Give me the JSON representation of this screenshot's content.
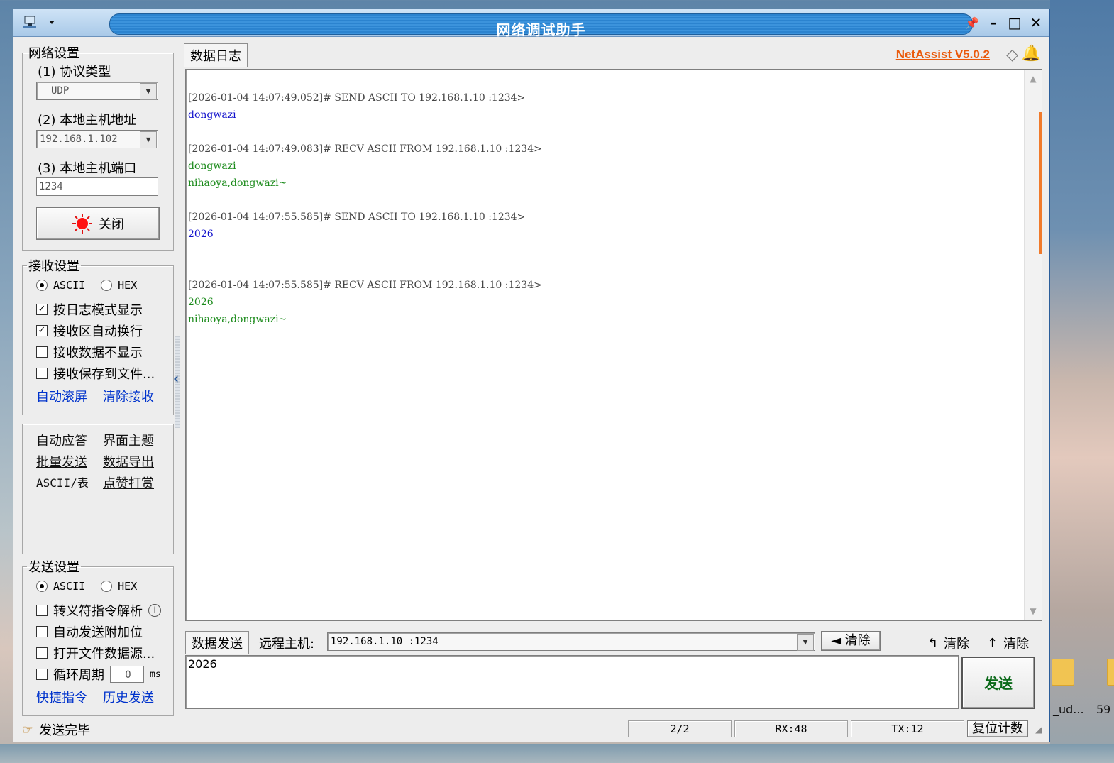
{
  "window": {
    "title": "网络调试助手"
  },
  "brand": {
    "name": "NetAssist V5.0.2"
  },
  "network_settings": {
    "legend": "网络设置",
    "protocol_label": "(1) 协议类型",
    "protocol_value": "UDP",
    "host_label": "(2) 本地主机地址",
    "host_value": "192.168.1.102",
    "port_label": "(3) 本地主机端口",
    "port_value": "1234",
    "close_button": "关闭"
  },
  "recv_settings": {
    "legend": "接收设置",
    "ascii_label": "ASCII",
    "hex_label": "HEX",
    "options": [
      {
        "label": "按日志模式显示",
        "checked": true
      },
      {
        "label": "接收区自动换行",
        "checked": true
      },
      {
        "label": "接收数据不显示",
        "checked": false
      },
      {
        "label": "接收保存到文件...",
        "checked": false
      }
    ],
    "auto_scroll": "自动滚屏",
    "clear_recv": "清除接收"
  },
  "tools": {
    "auto_reply": "自动应答",
    "theme": "界面主题",
    "batch_send": "批量发送",
    "export": "数据导出",
    "ascii_table": "ASCII/表",
    "reward": "点赞打赏"
  },
  "send_settings": {
    "legend": "发送设置",
    "ascii_label": "ASCII",
    "hex_label": "HEX",
    "options": [
      {
        "label": "转义符指令解析",
        "checked": false
      },
      {
        "label": "自动发送附加位",
        "checked": false
      },
      {
        "label": "打开文件数据源...",
        "checked": false
      }
    ],
    "cycle_label": "循环周期",
    "cycle_value": "0",
    "cycle_unit": "ms",
    "shortcuts": "快捷指令",
    "history": "历史发送"
  },
  "log": {
    "tab": "数据日志",
    "lines": [
      {
        "text": "[2026-01-04 14:07:49.052]# SEND ASCII TO 192.168.1.10 :1234>",
        "kind": "header"
      },
      {
        "text": "dongwazi",
        "kind": "send"
      },
      {
        "text": "",
        "kind": "blank"
      },
      {
        "text": "[2026-01-04 14:07:49.083]# RECV ASCII FROM 192.168.1.10 :1234>",
        "kind": "header"
      },
      {
        "text": "dongwazi",
        "kind": "recv"
      },
      {
        "text": "nihaoya,dongwazi~",
        "kind": "recv"
      },
      {
        "text": "",
        "kind": "blank"
      },
      {
        "text": "[2026-01-04 14:07:55.585]# SEND ASCII TO 192.168.1.10 :1234>",
        "kind": "header"
      },
      {
        "text": "2026",
        "kind": "send"
      },
      {
        "text": "",
        "kind": "blank"
      },
      {
        "text": "",
        "kind": "blank"
      },
      {
        "text": "[2026-01-04 14:07:55.585]# RECV ASCII FROM 192.168.1.10 :1234>",
        "kind": "header"
      },
      {
        "text": "2026",
        "kind": "recv"
      },
      {
        "text": "nihaoya,dongwazi~",
        "kind": "recv"
      }
    ]
  },
  "send": {
    "tab": "数据发送",
    "remote_label": "远程主机:",
    "remote_value": "192.168.1.10 :1234",
    "clear_btn": "清除",
    "clear2": "清除",
    "clear3": "清除",
    "text": "2026",
    "send_btn": "发送"
  },
  "status": {
    "message": "发送完毕",
    "page": "2/2",
    "rx": "RX:48",
    "tx": "TX:12",
    "reset": "复位计数"
  },
  "desktop": {
    "label1": "_ud...",
    "label2": "59"
  }
}
